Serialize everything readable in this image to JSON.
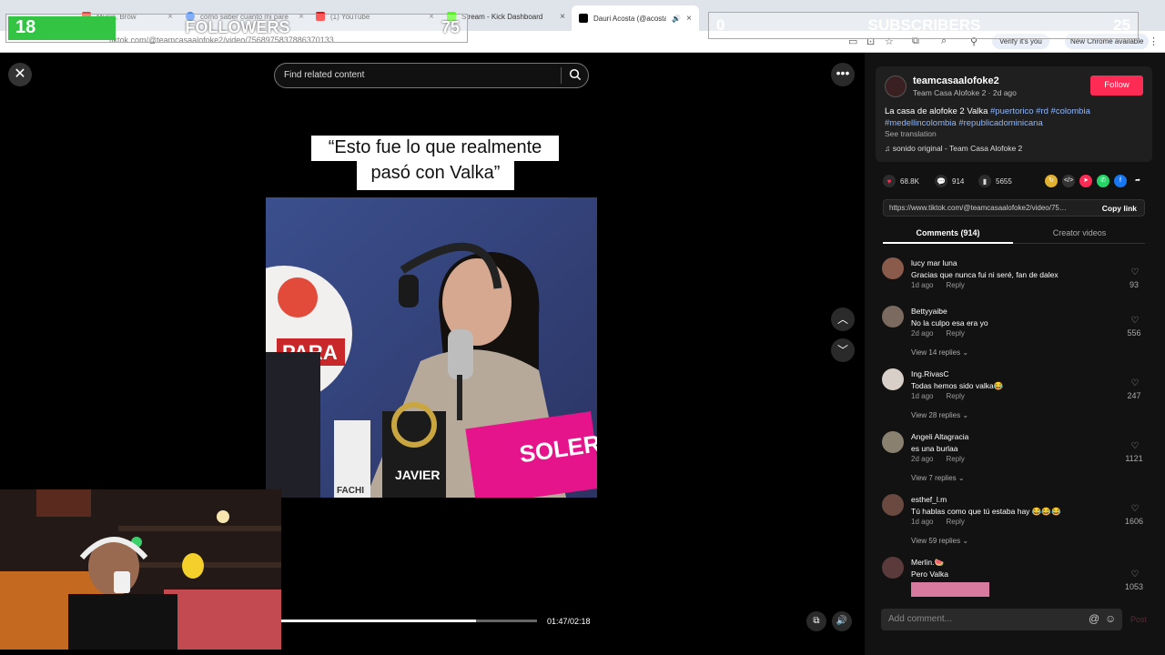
{
  "browser": {
    "tabs": [
      {
        "label": "Music, Brow",
        "active": false,
        "favicon": "#ea4335"
      },
      {
        "label": "como saber cuanto mi pare",
        "active": false,
        "favicon": "#4285f4"
      },
      {
        "label": "(1) YouTube",
        "active": false,
        "favicon": "#ff0000"
      },
      {
        "label": "Stream - Kick Dashboard",
        "active": false,
        "favicon": "#53fc18"
      },
      {
        "label": "Dauri Acosta (@acostad",
        "active": true,
        "favicon": "#000000"
      }
    ],
    "url": "tiktok.com/@teamcasaalofoke2/video/7568975837886370133",
    "verify_label": "Verify it's you",
    "new_chrome_label": "New Chrome available"
  },
  "overlay": {
    "followers": {
      "current": "18",
      "label": "FOLLOWERS",
      "goal": "75"
    },
    "subscribers": {
      "current": "0",
      "label": "SUBSCRIBERS",
      "goal": "25"
    }
  },
  "player": {
    "search_placeholder": "Find related content",
    "caption_line1": "“Esto fue lo que realmente",
    "caption_line2": "pasó con Valka”",
    "time": "01:47/02:18",
    "progress": 0.76,
    "scene_text": {
      "name_tag": "JAVIER",
      "laptop_brand": "SOLER",
      "logo_text": "PARA",
      "cup_text": "FACHI"
    }
  },
  "post": {
    "username": "teamcasaalofoke2",
    "subtitle": "Team Casa Alofoke 2 · 2d ago",
    "follow_label": "Follow",
    "description": "La casa de alofoke 2 Valka",
    "hashtags_line1": "#puertorico #rd #colombia",
    "hashtags_line2": "#medellincolombia #republicadominicana",
    "see_translation": "See translation",
    "music": "sonido original - Team Casa Alofoke 2",
    "likes": "68.8K",
    "comments": "914",
    "saves": "5655",
    "link": "https://www.tiktok.com/@teamcasaalofoke2/video/756...",
    "copy_link": "Copy link",
    "tab_comments": "Comments (914)",
    "tab_creator": "Creator videos"
  },
  "comments": [
    {
      "user": "lucy mar luna",
      "text": "Gracias que nunca fui ni seré, fan de dalex",
      "time": "1d ago",
      "reply": "Reply",
      "likes": "93",
      "replies": "",
      "avatar": "#8a5a4a"
    },
    {
      "user": "Bettyyaibe",
      "text": "No la culpo esa era yo",
      "time": "2d ago",
      "reply": "Reply",
      "likes": "556",
      "replies": "View 14 replies",
      "avatar": "#7a6a60"
    },
    {
      "user": "Ing.RivasC",
      "text": "Todas hemos sido valka😂",
      "time": "1d ago",
      "reply": "Reply",
      "likes": "247",
      "replies": "View 28 replies",
      "avatar": "#d8d0c8"
    },
    {
      "user": "Angeli Altagracia",
      "text": "es una burlaa",
      "time": "2d ago",
      "reply": "Reply",
      "likes": "1121",
      "replies": "View 7 replies",
      "avatar": "#8a8070"
    },
    {
      "user": "esthef_l.m",
      "text": "Tú hablas como que tú estaba hay 😂😂😂",
      "time": "1d ago",
      "reply": "Reply",
      "likes": "1606",
      "replies": "View 59 replies",
      "avatar": "#6a4a40"
    },
    {
      "user": "Merlin.🍉",
      "text": "Pero Valka",
      "time": "",
      "reply": "",
      "likes": "1053",
      "replies": "",
      "avatar": "#5a3a3a"
    }
  ],
  "composer": {
    "placeholder": "Add comment...",
    "post_label": "Post"
  }
}
